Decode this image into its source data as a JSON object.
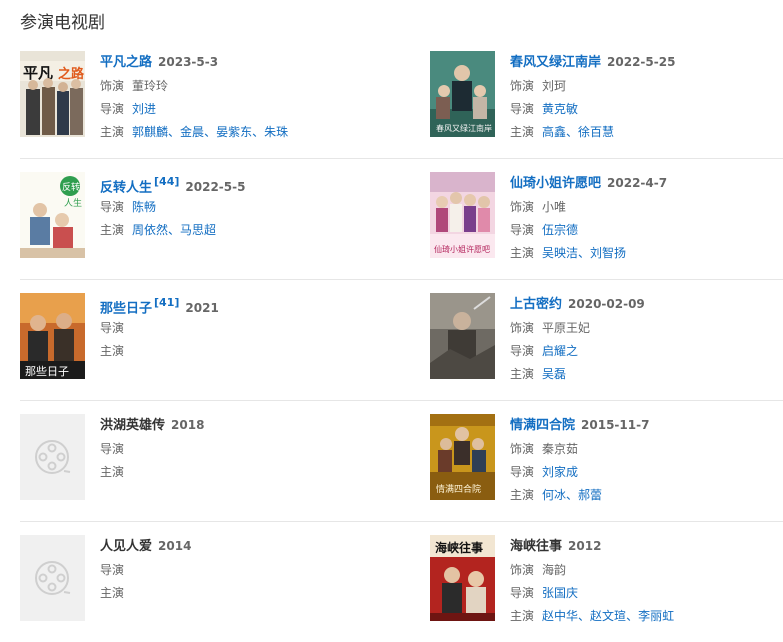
{
  "section_title": "参演电视剧",
  "labels": {
    "role": "饰演",
    "director": "导演",
    "cast": "主演",
    "sep": "、"
  },
  "rows": [
    [
      {
        "title": "平凡之路",
        "linked": true,
        "year": "2023-5-3",
        "role": "董玲玲",
        "director": "刘进",
        "cast": [
          "郭麒麟",
          "金晨",
          "晏紫东",
          "朱珠"
        ],
        "poster": "pingfan"
      },
      {
        "title": "春风又绿江南岸",
        "linked": true,
        "year": "2022-5-25",
        "role": "刘珂",
        "director": "黄克敏",
        "cast": [
          "高鑫",
          "徐百慧"
        ],
        "poster": "chunfeng"
      }
    ],
    [
      {
        "title": "反转人生",
        "linked": true,
        "sup": "[44]",
        "year": "2022-5-5",
        "director": "陈畅",
        "cast": [
          "周依然",
          "马思超"
        ],
        "poster": "fanzhuan"
      },
      {
        "title": "仙琦小姐许愿吧",
        "linked": true,
        "year": "2022-4-7",
        "role": "小唯",
        "director": "伍宗德",
        "cast": [
          "吴映洁",
          "刘智扬"
        ],
        "poster": "xianqi"
      }
    ],
    [
      {
        "title": "那些日子",
        "linked": true,
        "sup": "[41]",
        "year": "2021",
        "director": "",
        "cast": [],
        "poster": "naxie"
      },
      {
        "title": "上古密约",
        "linked": true,
        "year": "2020-02-09",
        "role": "平原王妃",
        "director": "启耀之",
        "cast": [
          "吴磊"
        ],
        "poster": "shanggu"
      }
    ],
    [
      {
        "title": "洪湖英雄传",
        "linked": false,
        "year": "2018",
        "director": "",
        "cast": [],
        "poster": "placeholder"
      },
      {
        "title": "情满四合院",
        "linked": true,
        "year": "2015-11-7",
        "role": "秦京茹",
        "director": "刘家成",
        "cast": [
          "何冰",
          "郝蕾"
        ],
        "poster": "qingman"
      }
    ],
    [
      {
        "title": "人见人爱",
        "linked": false,
        "year": "2014",
        "director": "",
        "cast": [],
        "poster": "placeholder"
      },
      {
        "title": "海峡往事",
        "linked": false,
        "year": "2012",
        "role": "海韵",
        "director": "张国庆",
        "cast": [
          "赵中华",
          "赵文瑄",
          "李丽虹"
        ],
        "poster": "haixia"
      }
    ]
  ]
}
